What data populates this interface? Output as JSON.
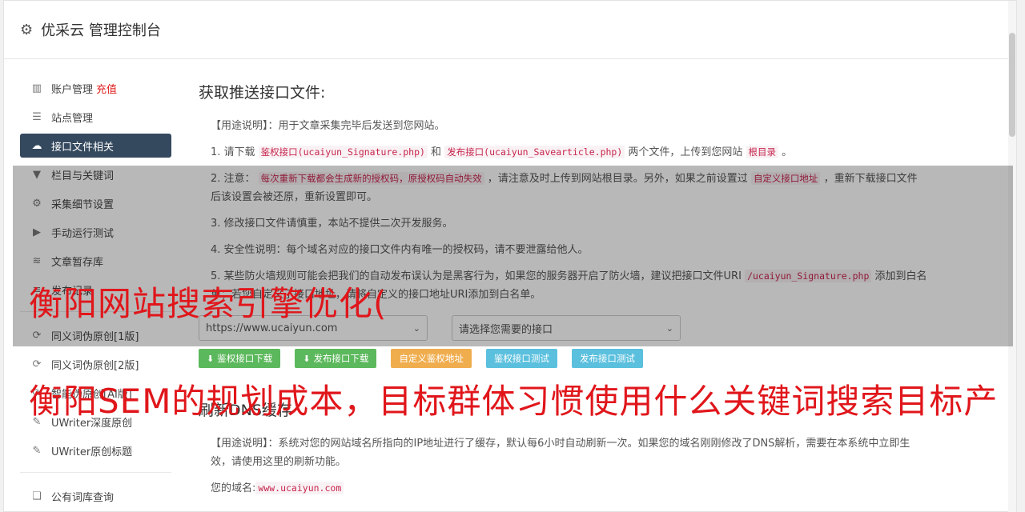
{
  "header": {
    "title": "优采云 管理控制台",
    "icon": "gear-icon"
  },
  "sidebar": {
    "items": [
      {
        "label": "账户管理",
        "extra": "充值",
        "icon": "bar-chart-icon"
      },
      {
        "label": "站点管理",
        "icon": "server-icon"
      },
      {
        "label": "接口文件相关",
        "icon": "cloud-upload-icon",
        "active": true
      },
      {
        "label": "栏目与关键词",
        "icon": "filter-icon"
      },
      {
        "label": "采集细节设置",
        "icon": "cogs-icon"
      },
      {
        "label": "手动运行测试",
        "icon": "play-icon"
      },
      {
        "label": "文章暂存库",
        "icon": "database-icon"
      },
      {
        "label": "发布记录",
        "icon": "list-icon"
      }
    ],
    "items2": [
      {
        "label": "同义词伪原创[1版]",
        "icon": "refresh-icon"
      },
      {
        "label": "同义词伪原创[2版]",
        "icon": "refresh-icon"
      },
      {
        "label": "智能伪原创[AI版]",
        "icon": "refresh-icon"
      },
      {
        "label": "UWriter深度原创",
        "icon": "edit-icon"
      },
      {
        "label": "UWriter原创标题",
        "icon": "edit-icon"
      }
    ],
    "items3": [
      {
        "label": "公有词库查询",
        "icon": "book-icon"
      }
    ]
  },
  "main": {
    "section1": {
      "title": "获取推送接口文件:",
      "usage": "【用途说明】：用于文章采集完毕后发送到您网站。",
      "p1_pre": "1. 请下载 ",
      "p1_code1": "鉴权接口(ucaiyun_Signature.php)",
      "p1_mid": " 和 ",
      "p1_code2": "发布接口(ucaiyun_Savearticle.php)",
      "p1_post": " 两个文件，上传到您网站 ",
      "p1_code3": "根目录",
      "p1_end": " 。",
      "p2_pre": "2. 注意： ",
      "p2_code1": "每次重新下载都会生成新的授权码，原授权码自动失效",
      "p2_mid": " ，请注意及时上传到网站根目录。另外，如果之前设置过 ",
      "p2_code2": "自定义接口地址",
      "p2_post": " ，重新下载接口文件后该设置会被还原，重新设置即可。",
      "p3": "3. 修改接口文件请慎重，本站不提供二次开发服务。",
      "p4": "4. 安全性说明：每个域名对应的接口文件内有唯一的授权码，请不要泄露给他人。",
      "p5_pre": "5. 某些防火墙规则可能会把我们的自动发布误认为是黑客行为，如果您的服务器开启了防火墙，建议把接口文件URI ",
      "p5_code": "/ucaiyun_Signature.php",
      "p5_post": " 添加到白名单；若您自定义了接口地址，请将自定义的接口地址URI添加到白名单。",
      "select_site": "https://www.ucaiyun.com",
      "select_interface": "请选择您需要的接口",
      "buttons": {
        "download_auth": "鉴权接口下载",
        "download_publish": "发布接口下载",
        "custom_auth": "自定义鉴权地址",
        "test_auth": "鉴权接口测试",
        "test_publish": "发布接口测试"
      }
    },
    "section2": {
      "title": "刷新DNS缓存",
      "usage": "【用途说明】：系统对您的网站域名所指向的IP地址进行了缓存，默认每6小时自动刷新一次。如果您的域名刚刚修改了DNS解析，需要在本系统中立即生效，请使用这里的刷新功能。",
      "domain_label": "您的域名:",
      "domain_value": "www.ucaiyun.com"
    }
  },
  "watermark": {
    "line1": "衡阳网站搜索引擎优化(",
    "line2": "衡阳SEM的规划成本，目标群体习惯使用什么关键词搜索目标产"
  }
}
